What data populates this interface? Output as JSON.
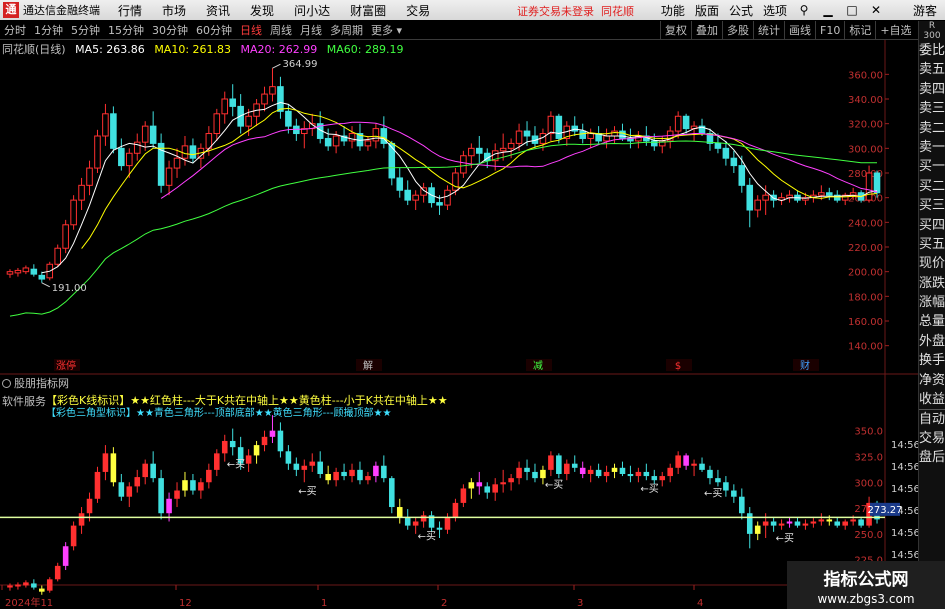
{
  "titlebar": {
    "app_title": "通达信金融终端",
    "menu": [
      "行情",
      "市场",
      "资讯",
      "发现",
      "问小达",
      "财富圈",
      "交易"
    ],
    "notice": "证券交易未登录",
    "stock_name": "同花顺",
    "right_menu": [
      "功能",
      "版面",
      "公式",
      "选项"
    ],
    "login": "游客"
  },
  "periods": [
    "分时",
    "1分钟",
    "5分钟",
    "15分钟",
    "30分钟",
    "60分钟",
    "日线",
    "周线",
    "月线",
    "多周期",
    "更多"
  ],
  "active_period": "日线",
  "tools": [
    "复权",
    "叠加",
    "多股",
    "统计",
    "画线",
    "F10",
    "标记",
    "+自选"
  ],
  "sidebar": {
    "head": "R",
    "head2": "300",
    "items": [
      "委比",
      "卖五",
      "卖四",
      "卖三",
      "卖二",
      "卖一",
      "买一",
      "买二",
      "买三",
      "买四",
      "买五",
      "现价",
      "涨跌",
      "涨幅",
      "总量",
      "外盘",
      "换手",
      "净资",
      "收益",
      "自动",
      "交易",
      "盘后"
    ],
    "sep_index": 19
  },
  "legend": {
    "title": "同花顺(日线)",
    "ma5": "MA5: 263.86",
    "ma10": "MA10: 261.83",
    "ma20": "MA20: 262.99",
    "ma60": "MA60: 289.19",
    "colors": {
      "ma5": "#ffffff",
      "ma10": "#ffff00",
      "ma20": "#ff40ff",
      "ma60": "#40ff40"
    }
  },
  "main_axis": {
    "labels": [
      "360.00",
      "340.00",
      "320.00",
      "300.00",
      "280.00",
      "260.00",
      "240.00",
      "220.00",
      "200.00",
      "180.00",
      "160.00",
      "140.00"
    ],
    "values": [
      360,
      340,
      320,
      300,
      280,
      260,
      240,
      220,
      200,
      180,
      160,
      140
    ]
  },
  "annotations": {
    "high": "364.99",
    "low": "191.00"
  },
  "event_labels": [
    "涨停",
    "解",
    "减",
    "$",
    "财"
  ],
  "sub_panel": {
    "title": "股朋指标网",
    "service": "软件服务",
    "line1": "【彩色K线标识】★★红色柱---大于K共在中轴上★★黄色柱---小于K共在中轴上★★",
    "line2": "【彩色三角型标识】★★青色三角形---顶部底部★★黄色三角形---顾撮顶部★★",
    "buy_label": "←买",
    "axis_labels": [
      "350.0",
      "325.0",
      "300.0",
      "275.0",
      "250.0",
      "225.0"
    ],
    "axis_values": [
      350,
      325,
      300,
      275,
      250,
      225
    ],
    "price_tag": "273.27",
    "time_labels": [
      "14:56",
      "14:56",
      "14:56",
      "14:56",
      "14:56",
      "14:56"
    ]
  },
  "xaxis": {
    "labels": [
      "2024年11",
      "12",
      "1",
      "2",
      "3",
      "4"
    ]
  },
  "watermark": {
    "line1": "指标公式网",
    "line2": "www.zbgs3.com"
  },
  "colors": {
    "up": "#ff3030",
    "down": "#40e0e0",
    "accent": "#d42121"
  },
  "chart_data": {
    "type": "candlestick",
    "ohlc": [
      [
        198,
        202,
        195,
        200
      ],
      [
        199,
        203,
        196,
        201
      ],
      [
        200,
        205,
        198,
        203
      ],
      [
        202,
        206,
        196,
        198
      ],
      [
        197,
        200,
        191,
        194
      ],
      [
        195,
        208,
        193,
        206
      ],
      [
        206,
        222,
        204,
        219
      ],
      [
        219,
        242,
        215,
        238
      ],
      [
        238,
        262,
        234,
        258
      ],
      [
        258,
        276,
        250,
        270
      ],
      [
        270,
        290,
        262,
        284
      ],
      [
        284,
        315,
        280,
        310
      ],
      [
        310,
        336,
        302,
        328
      ],
      [
        328,
        334,
        296,
        300
      ],
      [
        300,
        308,
        282,
        286
      ],
      [
        286,
        300,
        276,
        296
      ],
      [
        296,
        312,
        290,
        305
      ],
      [
        305,
        322,
        298,
        318
      ],
      [
        318,
        330,
        300,
        304
      ],
      [
        304,
        312,
        264,
        270
      ],
      [
        270,
        290,
        262,
        284
      ],
      [
        284,
        300,
        276,
        292
      ],
      [
        292,
        310,
        286,
        302
      ],
      [
        302,
        308,
        288,
        292
      ],
      [
        292,
        304,
        284,
        300
      ],
      [
        300,
        318,
        294,
        312
      ],
      [
        312,
        332,
        306,
        328
      ],
      [
        328,
        346,
        320,
        340
      ],
      [
        340,
        352,
        326,
        334
      ],
      [
        334,
        344,
        312,
        318
      ],
      [
        318,
        332,
        310,
        326
      ],
      [
        326,
        340,
        318,
        336
      ],
      [
        336,
        350,
        330,
        344
      ],
      [
        344,
        365,
        338,
        350
      ],
      [
        350,
        358,
        324,
        330
      ],
      [
        330,
        336,
        312,
        318
      ],
      [
        318,
        324,
        306,
        312
      ],
      [
        312,
        322,
        300,
        316
      ],
      [
        316,
        328,
        310,
        320
      ],
      [
        320,
        330,
        304,
        308
      ],
      [
        308,
        316,
        298,
        302
      ],
      [
        302,
        314,
        296,
        310
      ],
      [
        310,
        318,
        302,
        306
      ],
      [
        306,
        318,
        300,
        312
      ],
      [
        312,
        320,
        298,
        302
      ],
      [
        302,
        310,
        298,
        306
      ],
      [
        306,
        320,
        300,
        316
      ],
      [
        316,
        326,
        300,
        304
      ],
      [
        304,
        306,
        270,
        276
      ],
      [
        276,
        284,
        260,
        266
      ],
      [
        266,
        274,
        254,
        258
      ],
      [
        258,
        266,
        250,
        262
      ],
      [
        262,
        272,
        256,
        268
      ],
      [
        268,
        272,
        252,
        256
      ],
      [
        256,
        262,
        246,
        254
      ],
      [
        254,
        270,
        250,
        266
      ],
      [
        266,
        284,
        262,
        280
      ],
      [
        280,
        298,
        276,
        294
      ],
      [
        294,
        304,
        284,
        300
      ],
      [
        300,
        310,
        288,
        296
      ],
      [
        296,
        300,
        284,
        290
      ],
      [
        290,
        304,
        282,
        298
      ],
      [
        298,
        312,
        290,
        300
      ],
      [
        300,
        308,
        292,
        304
      ],
      [
        304,
        320,
        298,
        314
      ],
      [
        314,
        322,
        302,
        310
      ],
      [
        310,
        318,
        300,
        304
      ],
      [
        304,
        316,
        298,
        312
      ],
      [
        312,
        330,
        306,
        326
      ],
      [
        326,
        328,
        304,
        308
      ],
      [
        308,
        322,
        302,
        318
      ],
      [
        318,
        326,
        310,
        314
      ],
      [
        314,
        320,
        304,
        308
      ],
      [
        308,
        316,
        300,
        312
      ],
      [
        312,
        318,
        304,
        306
      ],
      [
        306,
        316,
        300,
        310
      ],
      [
        310,
        318,
        304,
        314
      ],
      [
        314,
        320,
        306,
        308
      ],
      [
        308,
        316,
        300,
        306
      ],
      [
        306,
        314,
        300,
        310
      ],
      [
        310,
        318,
        302,
        306
      ],
      [
        306,
        312,
        298,
        302
      ],
      [
        302,
        310,
        296,
        306
      ],
      [
        306,
        318,
        300,
        314
      ],
      [
        314,
        330,
        308,
        326
      ],
      [
        326,
        328,
        312,
        316
      ],
      [
        316,
        322,
        306,
        318
      ],
      [
        318,
        324,
        310,
        312
      ],
      [
        312,
        316,
        298,
        304
      ],
      [
        304,
        312,
        296,
        300
      ],
      [
        300,
        306,
        286,
        292
      ],
      [
        292,
        298,
        280,
        286
      ],
      [
        286,
        294,
        264,
        270
      ],
      [
        270,
        276,
        236,
        250
      ],
      [
        250,
        262,
        244,
        258
      ],
      [
        258,
        270,
        246,
        262
      ],
      [
        262,
        266,
        252,
        258
      ],
      [
        258,
        264,
        254,
        260
      ],
      [
        260,
        266,
        256,
        262
      ],
      [
        262,
        266,
        256,
        258
      ],
      [
        258,
        264,
        254,
        260
      ],
      [
        260,
        266,
        256,
        262
      ],
      [
        262,
        270,
        258,
        264
      ],
      [
        264,
        268,
        258,
        262
      ],
      [
        262,
        266,
        256,
        258
      ],
      [
        258,
        264,
        254,
        262
      ],
      [
        262,
        268,
        258,
        264
      ],
      [
        264,
        266,
        256,
        258
      ],
      [
        258,
        286,
        256,
        280
      ],
      [
        280,
        282,
        260,
        264
      ]
    ],
    "ma5": [],
    "y_range": [
      130,
      370
    ],
    "sub_y_range": [
      215,
      370
    ],
    "high": 364.99,
    "low": 191.0
  }
}
